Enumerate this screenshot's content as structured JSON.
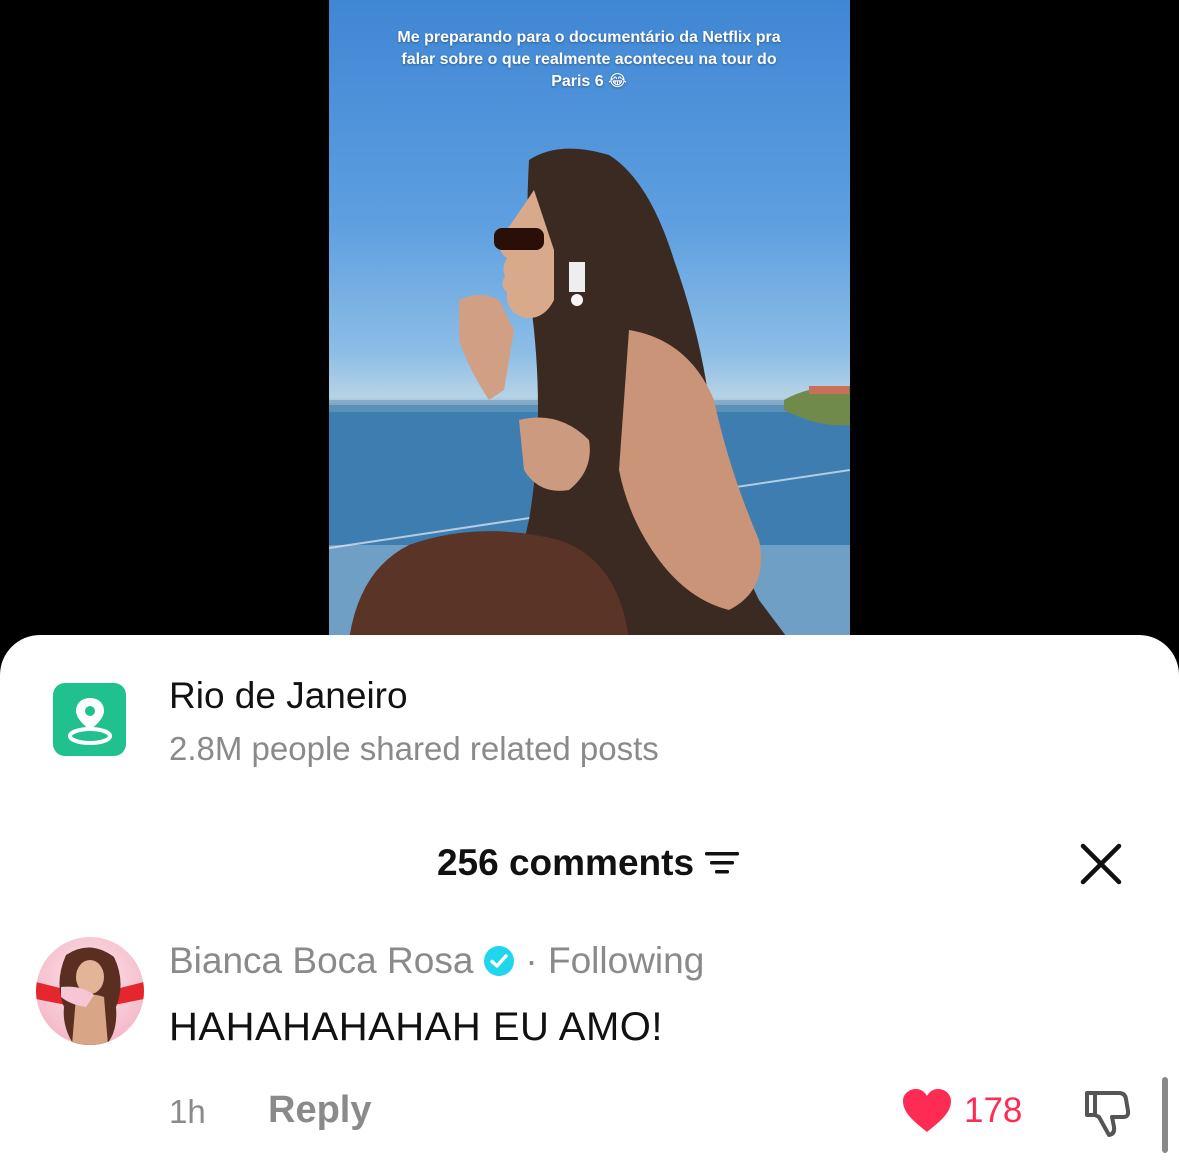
{
  "video": {
    "caption": "Me preparando para o documentário da Netflix pra falar sobre o que realmente aconteceu na tour do Paris 6 😂"
  },
  "location": {
    "icon": "location-pin-icon",
    "title": "Rio de Janeiro",
    "subtitle": "2.8M people shared related posts",
    "accent": "#20c08f"
  },
  "comments": {
    "header": "256 comments",
    "sort_icon": "sort-filter-icon",
    "close_icon": "close-icon",
    "items": [
      {
        "username": "Bianca Boca Rosa",
        "verified": true,
        "relation": "· Following",
        "text": "HAHAHAHAHAH EU AMO!",
        "time": "1h",
        "reply_label": "Reply",
        "likes": "178",
        "liked": true,
        "like_color": "#fe2c55"
      }
    ]
  }
}
